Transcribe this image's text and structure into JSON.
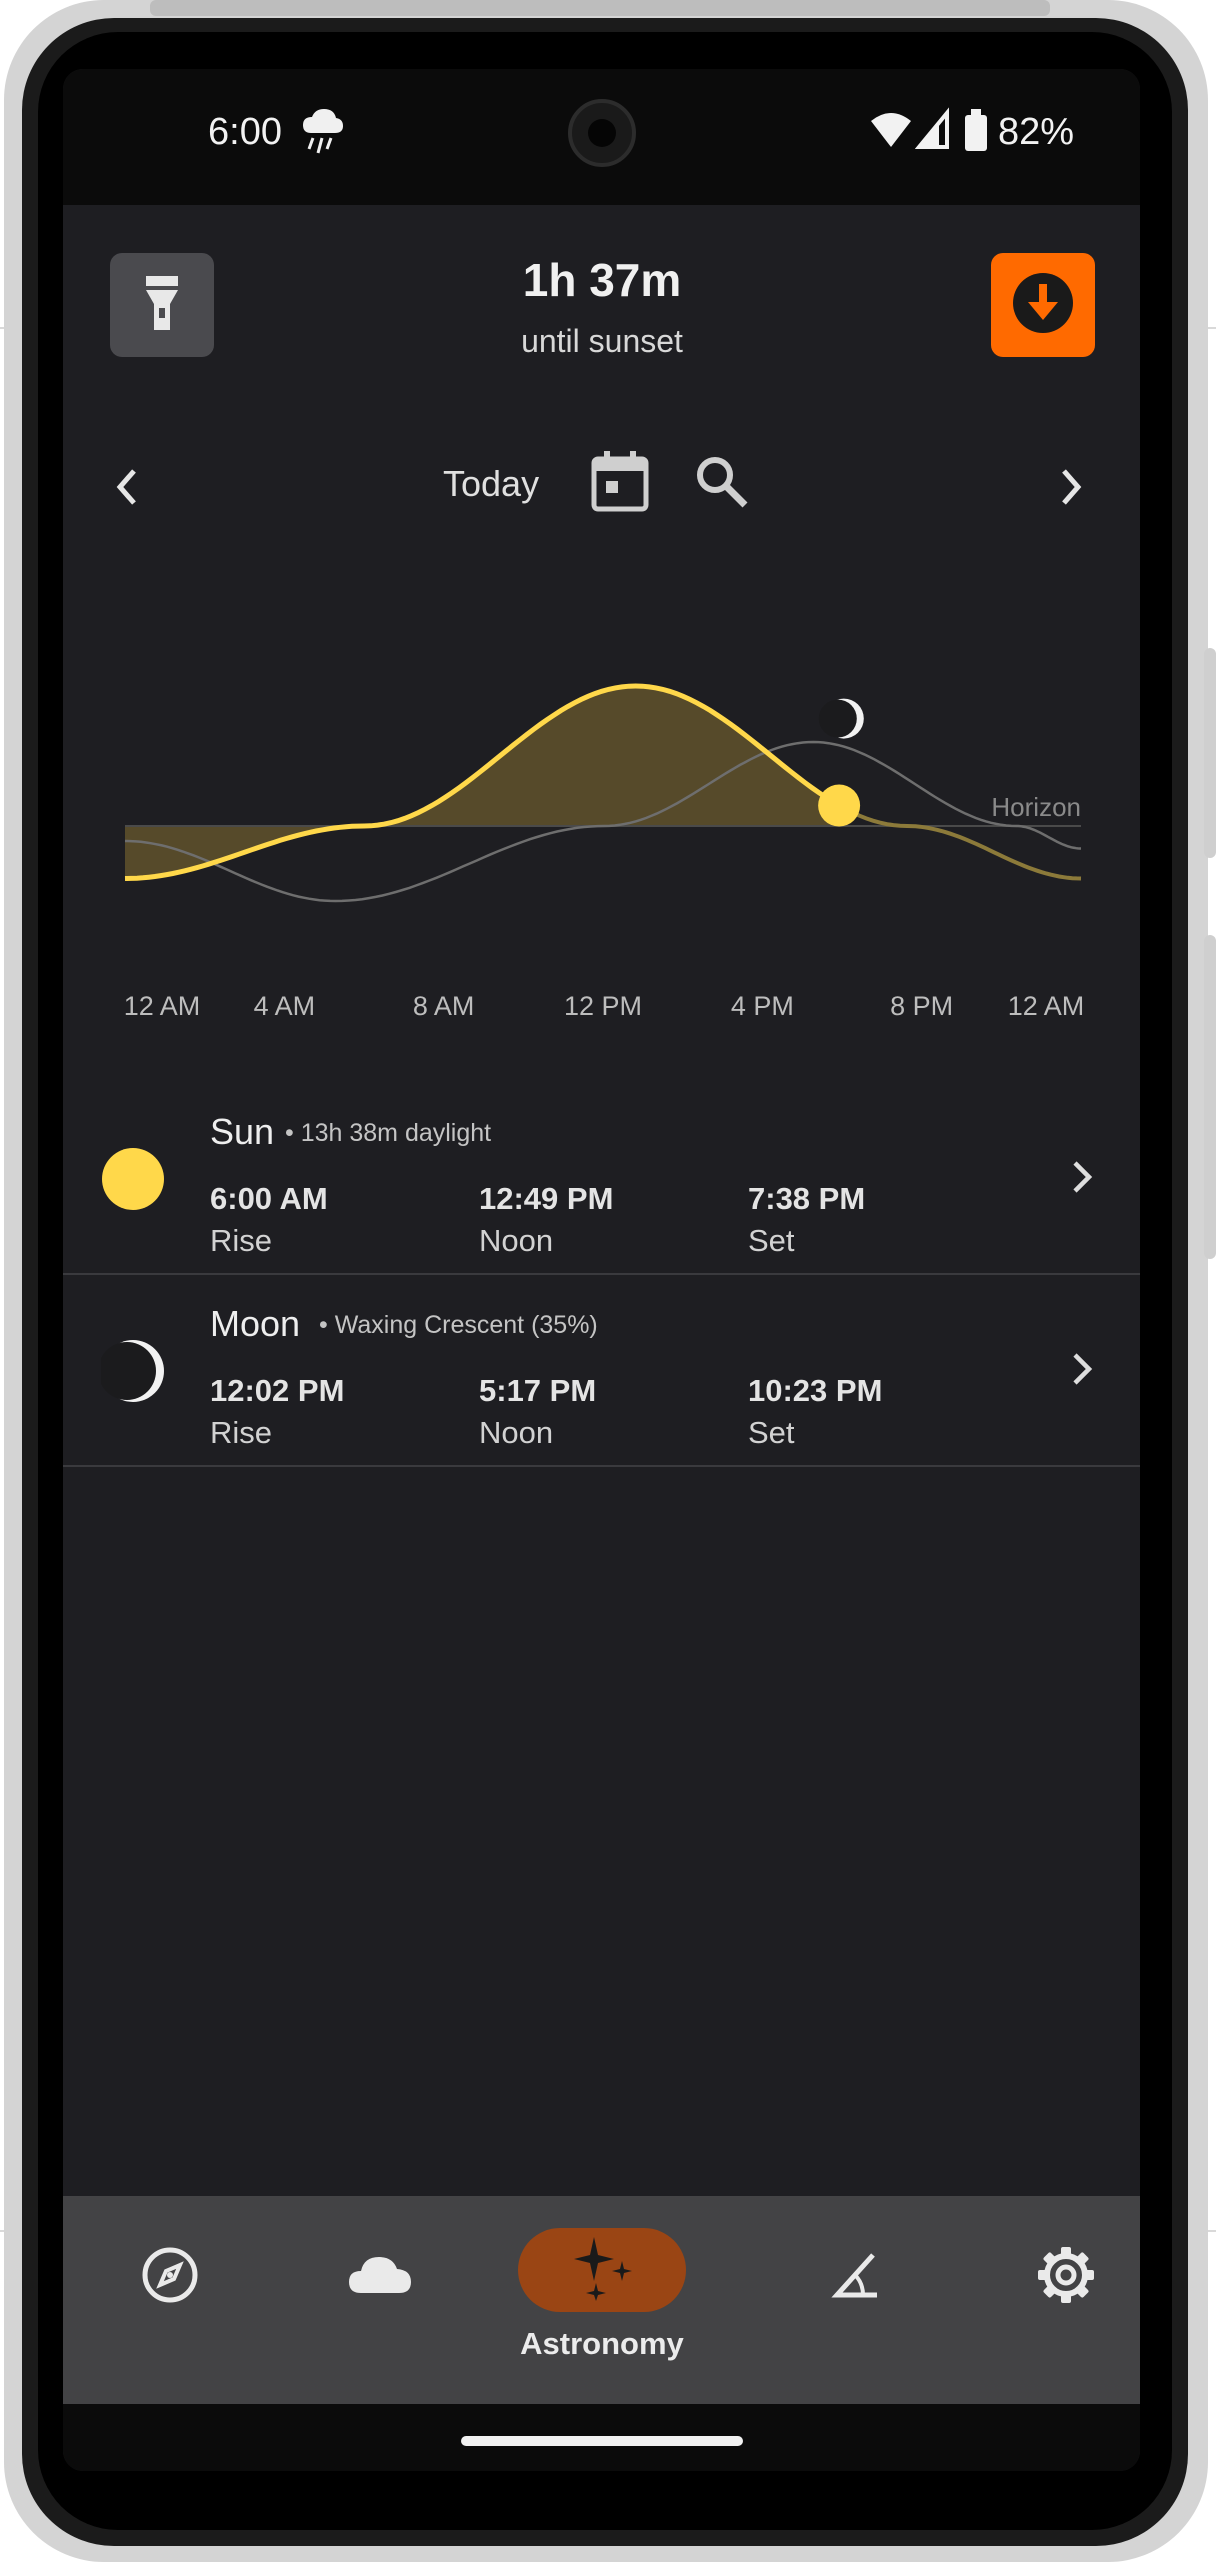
{
  "status_bar": {
    "time": "6:00",
    "battery_percent": "82%",
    "icons": [
      "rain-cloud-icon",
      "wifi-icon",
      "cell-signal-icon",
      "battery-icon"
    ]
  },
  "header": {
    "title": "1h 37m",
    "subtitle": "until sunset",
    "left_button_icon": "flashlight-icon",
    "right_button_icon": "download-icon",
    "accent_color": "#ff6a00"
  },
  "date_nav": {
    "label": "Today",
    "icons": [
      "chevron-left-icon",
      "calendar-icon",
      "search-icon",
      "chevron-right-icon"
    ]
  },
  "chart_data": {
    "type": "line",
    "x_ticks": [
      "12 AM",
      "4 AM",
      "8 AM",
      "12 PM",
      "4 PM",
      "8 PM",
      "12 AM"
    ],
    "annotations": [
      "Horizon"
    ],
    "series": [
      {
        "name": "Sun",
        "color": "#ffd84a",
        "x_hours": [
          0,
          6.0,
          12.82,
          19.63,
          24
        ],
        "y_relative": [
          -0.7,
          0,
          1,
          0,
          -0.7
        ]
      },
      {
        "name": "Moon",
        "color": "#6e6e6e",
        "x_hours": [
          0,
          5.28,
          12.03,
          17.28,
          22.38,
          24
        ],
        "y_relative": [
          -0.2,
          -1,
          0,
          0.6,
          0,
          -0.3
        ]
      }
    ],
    "current_time_hours": 18.0
  },
  "rows": [
    {
      "name": "Sun",
      "detail": "13h 38m daylight",
      "times": [
        {
          "value": "6:00 AM",
          "label": "Rise"
        },
        {
          "value": "12:49 PM",
          "label": "Noon"
        },
        {
          "value": "7:38 PM",
          "label": "Set"
        }
      ]
    },
    {
      "name": "Moon",
      "detail": "Waxing Crescent (35%)",
      "times": [
        {
          "value": "12:02 PM",
          "label": "Rise"
        },
        {
          "value": "5:17 PM",
          "label": "Noon"
        },
        {
          "value": "10:23 PM",
          "label": "Set"
        }
      ]
    }
  ],
  "bottom_nav": {
    "active_label": "Astronomy",
    "items": [
      "navigation-compass-icon",
      "weather-cloud-icon",
      "astronomy-sparkle-icon",
      "clinometer-angle-icon",
      "settings-gear-icon"
    ],
    "active_color": "#9a4514"
  }
}
